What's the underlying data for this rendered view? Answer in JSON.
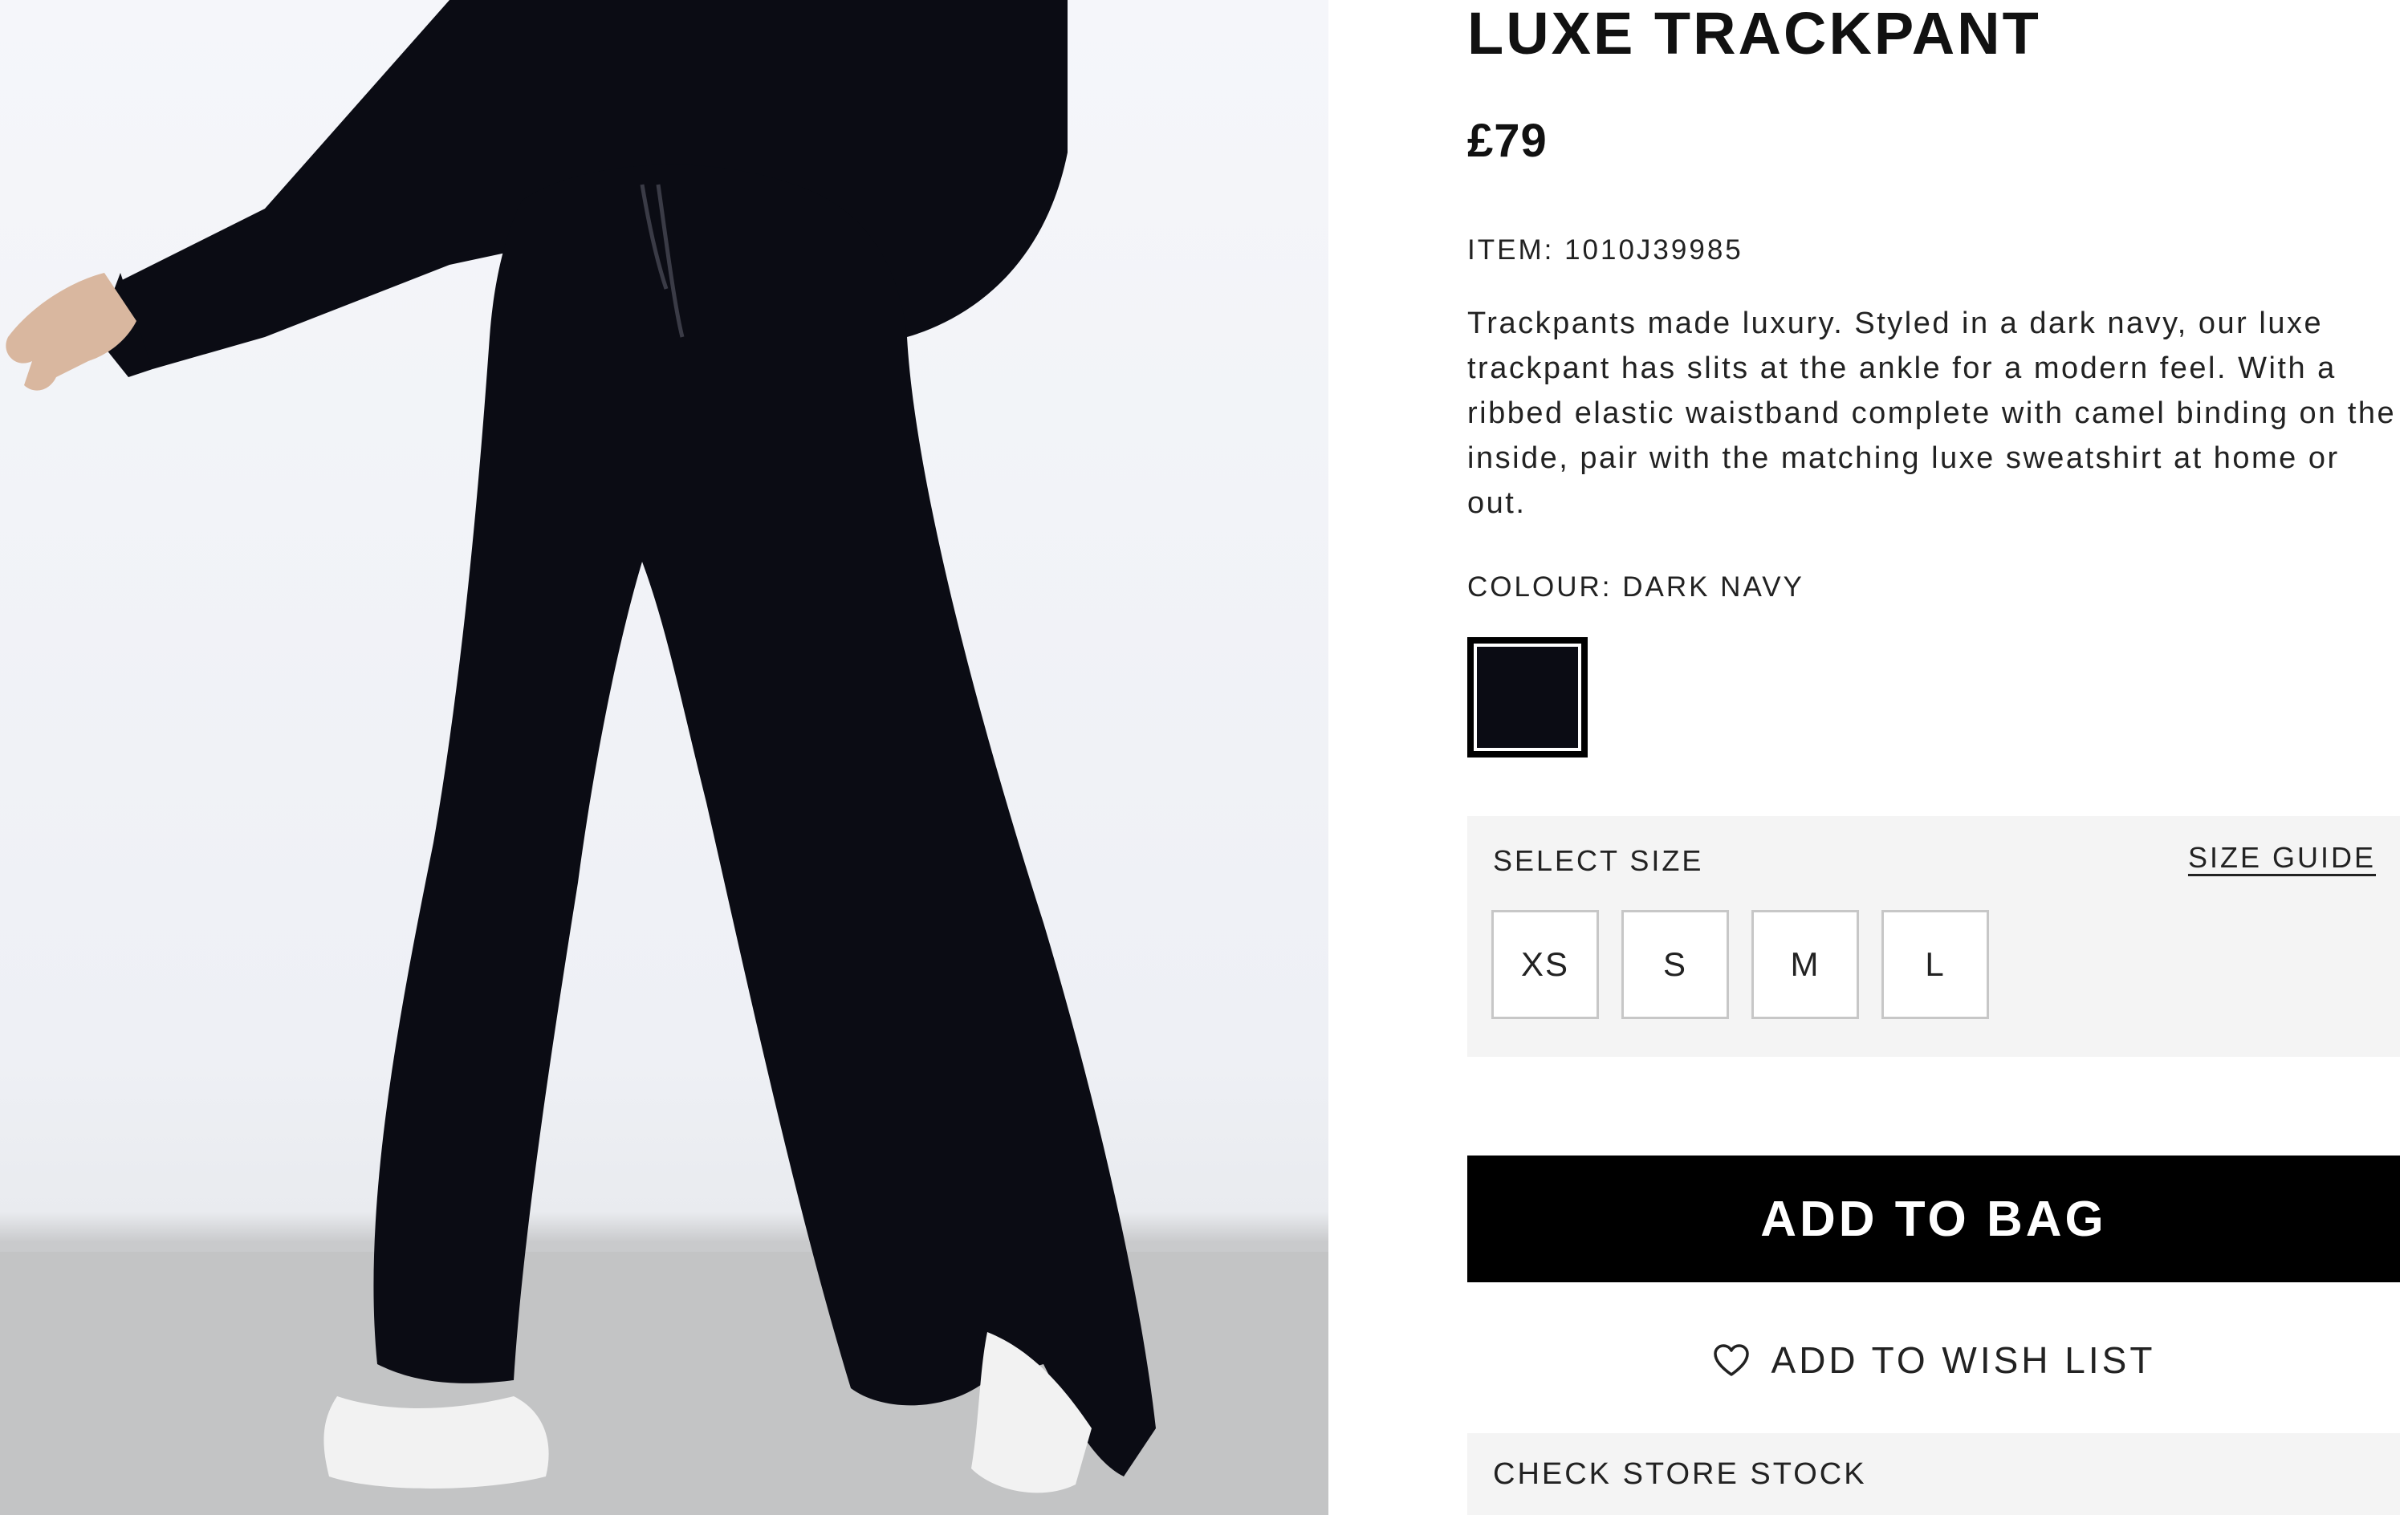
{
  "product": {
    "title": "LUXE TRACKPANT",
    "price": "£79",
    "item_label": "ITEM:",
    "item_number": "1010J39985",
    "description": "Trackpants made luxury. Styled in a dark navy, our luxe trackpant has slits at the ankle for a modern feel. With a ribbed elastic waistband complete with camel binding on the inside, pair with the matching luxe sweatshirt at home or out.",
    "colour_label": "COLOUR:",
    "colour_value": "DARK NAVY",
    "swatch_color": "#0b0c14"
  },
  "size_selector": {
    "label": "SELECT SIZE",
    "guide_link": "SIZE GUIDE",
    "sizes": [
      "XS",
      "S",
      "M",
      "L"
    ]
  },
  "actions": {
    "add_to_bag": "ADD TO BAG",
    "wish_list": "ADD TO WISH LIST",
    "check_store_stock": "CHECK STORE STOCK"
  },
  "colors": {
    "primary_button": "#000000",
    "panel_background": "#f4f4f4",
    "garment": "#0b0c14"
  },
  "icons": {
    "wish_list": "heart-icon"
  }
}
